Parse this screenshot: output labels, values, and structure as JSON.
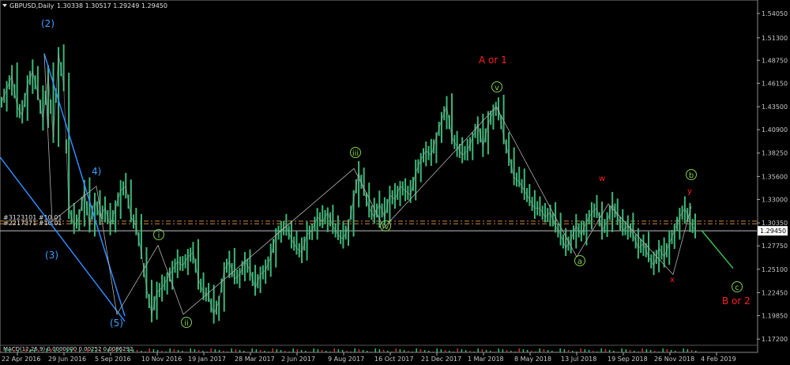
{
  "header": {
    "symbol": "GBPUSD,Daily",
    "ohlc": "1.30338 1.30517 1.29249 1.29450"
  },
  "current_price_label": "1.29450",
  "indicator_label": "MACD(12,26,9) 0.0000000 0.00252 0.0086292",
  "colors": {
    "background": "#000000",
    "candles": "#3cb878",
    "trendline": "#2f8cff",
    "wave_line": "#b0b0b0",
    "level_orange": "#d08a3a",
    "projection": "#3cbf4a",
    "current_price_line": "#c0c0c0"
  },
  "chart_data": {
    "type": "line",
    "title": "",
    "xlabel": "",
    "ylabel": "",
    "ylim": [
      1.165,
      1.545
    ],
    "y_ticks": [
      "1.54050",
      "1.51300",
      "1.48750",
      "1.46150",
      "1.43500",
      "1.40900",
      "1.38250",
      "1.35600",
      "1.33000",
      "1.30350",
      "1.27750",
      "1.25100",
      "1.22450",
      "1.19850",
      "1.17200"
    ],
    "y_tick_values": [
      1.5405,
      1.513,
      1.4875,
      1.4615,
      1.435,
      1.409,
      1.3825,
      1.356,
      1.33,
      1.3035,
      1.2775,
      1.251,
      1.2245,
      1.1985,
      1.172
    ],
    "x_ticks": [
      "22 Apr 2016",
      "29 Jun 2016",
      "5 Sep 2016",
      "10 Nov 2016",
      "19 Jan 2017",
      "28 Mar 2017",
      "2 Jun 2017",
      "9 Aug 2017",
      "16 Oct 2017",
      "21 Dec 2017",
      "1 Mar 2018",
      "8 May 2018",
      "13 Jul 2018",
      "19 Sep 2018",
      "26 Nov 2018",
      "4 Feb 2019"
    ],
    "series": [
      {
        "values": [
          1.44,
          1.455,
          1.47,
          1.435,
          1.425,
          1.46,
          1.475,
          1.45,
          1.42,
          1.47,
          1.4,
          1.495,
          1.46,
          1.32,
          1.3,
          1.31,
          1.34,
          1.3,
          1.33,
          1.31,
          1.32,
          1.3,
          1.32,
          1.34,
          1.345,
          1.31,
          1.3,
          1.27,
          1.23,
          1.2,
          1.225,
          1.23,
          1.24,
          1.25,
          1.26,
          1.255,
          1.265,
          1.27,
          1.24,
          1.225,
          1.22,
          1.2,
          1.215,
          1.25,
          1.26,
          1.24,
          1.245,
          1.26,
          1.25,
          1.23,
          1.245,
          1.25,
          1.265,
          1.29,
          1.295,
          1.3,
          1.285,
          1.275,
          1.27,
          1.29,
          1.295,
          1.31,
          1.305,
          1.315,
          1.3,
          1.29,
          1.285,
          1.3,
          1.33,
          1.36,
          1.34,
          1.32,
          1.31,
          1.325,
          1.31,
          1.335,
          1.33,
          1.345,
          1.34,
          1.335,
          1.36,
          1.375,
          1.385,
          1.38,
          1.4,
          1.42,
          1.435,
          1.4,
          1.39,
          1.38,
          1.385,
          1.4,
          1.415,
          1.39,
          1.415,
          1.43,
          1.435,
          1.4,
          1.38,
          1.355,
          1.35,
          1.34,
          1.33,
          1.32,
          1.32,
          1.31,
          1.315,
          1.3,
          1.29,
          1.275,
          1.285,
          1.3,
          1.29,
          1.305,
          1.315,
          1.32,
          1.295,
          1.305,
          1.325,
          1.31,
          1.295,
          1.3,
          1.29,
          1.275,
          1.28,
          1.265,
          1.255,
          1.275,
          1.265,
          1.28,
          1.295,
          1.31,
          1.32,
          1.305,
          1.295
        ]
      }
    ],
    "levels": [
      1.3055,
      1.3025,
      1.2945
    ],
    "level_labels": [
      "#3123101 #10.01",
      "#2217371 #10.01"
    ],
    "wave_labels": [
      {
        "text": "(2)",
        "style": "blue"
      },
      {
        "text": "(3)",
        "style": "blue"
      },
      {
        "text": "4)",
        "style": "blue"
      },
      {
        "text": "(5)",
        "style": "blue"
      },
      {
        "text": "i",
        "style": "green"
      },
      {
        "text": "ii",
        "style": "green"
      },
      {
        "text": "iii",
        "style": "green"
      },
      {
        "text": "iv",
        "style": "green"
      },
      {
        "text": "v",
        "style": "green"
      },
      {
        "text": "A or 1",
        "style": "red"
      },
      {
        "text": "w",
        "style": "red-s"
      },
      {
        "text": "x",
        "style": "red-s"
      },
      {
        "text": "y",
        "style": "red-s"
      },
      {
        "text": "a",
        "style": "green"
      },
      {
        "text": "b",
        "style": "green"
      },
      {
        "text": "c",
        "style": "green"
      },
      {
        "text": "B or 2",
        "style": "red"
      }
    ]
  }
}
